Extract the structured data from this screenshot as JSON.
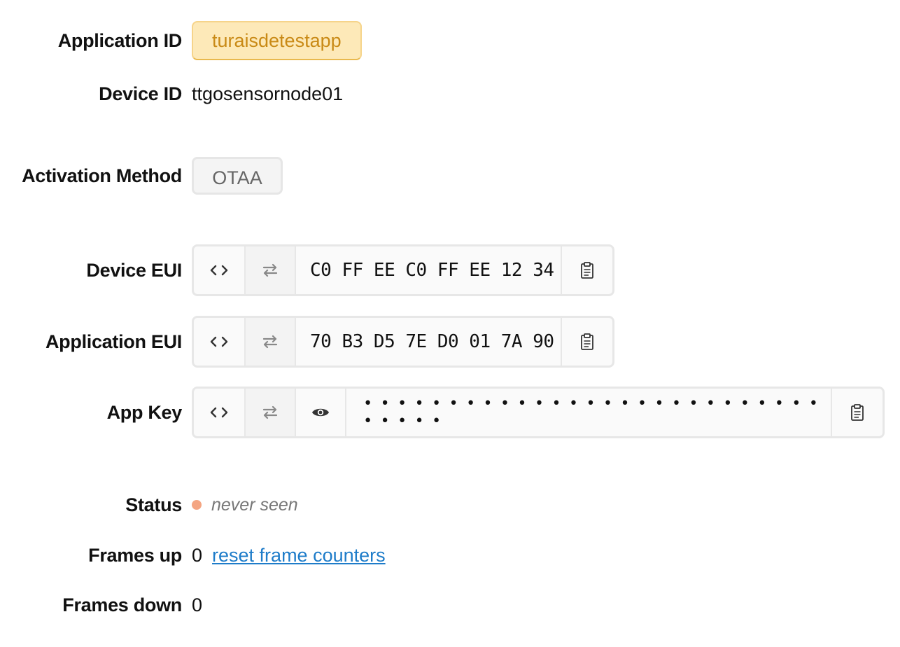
{
  "application": {
    "label": "Application ID",
    "value": "turaisdetestapp"
  },
  "device": {
    "label": "Device ID",
    "value": "ttgosensornode01"
  },
  "activation": {
    "label": "Activation Method",
    "value": "OTAA"
  },
  "device_eui": {
    "label": "Device EUI",
    "value": "C0 FF EE C0 FF EE 12 34"
  },
  "app_eui": {
    "label": "Application EUI",
    "value": "70 B3 D5 7E D0 01 7A 90"
  },
  "app_key": {
    "label": "App Key",
    "value": "• • • • • • • • • • • • • • • • • • • • • • • • • • • • • • • •"
  },
  "icons": {
    "format": "code-brackets-icon",
    "swap": "swap-arrows-icon",
    "reveal": "eye-icon",
    "copy": "clipboard-icon"
  },
  "status": {
    "label": "Status",
    "value": "never seen",
    "dot_color": "#f4a582"
  },
  "frames_up": {
    "label": "Frames up",
    "value": "0",
    "reset_link": "reset frame counters"
  },
  "frames_down": {
    "label": "Frames down",
    "value": "0"
  },
  "colors": {
    "accent_badge_bg": "#fde9b8",
    "accent_badge_text": "#c98a16",
    "link": "#1e7cc9"
  }
}
